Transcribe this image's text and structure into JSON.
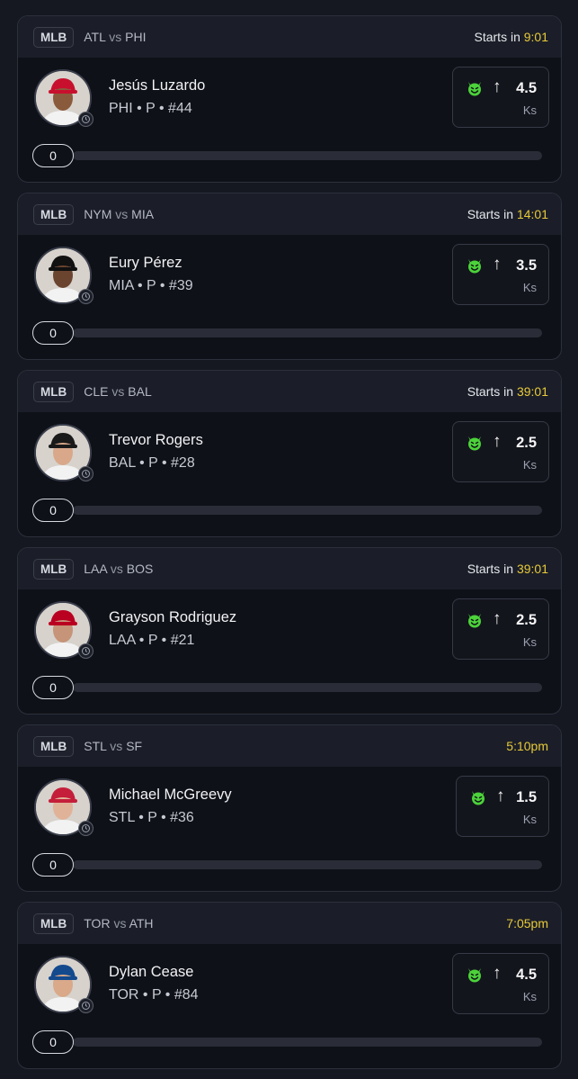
{
  "colors": {
    "countdown": "#e7c93a",
    "prop_icon": "#4cd23a",
    "background": "#151821"
  },
  "cards": [
    {
      "league": "MLB",
      "home": "ATL",
      "vs": "vs",
      "away": "PHI",
      "time_prefix": "Starts in ",
      "time_value": "9:01",
      "player": "Jesús Luzardo",
      "meta": "PHI • P • #44",
      "line": "4.5",
      "stat": "Ks",
      "direction": "up",
      "count": "0",
      "icon": "devil-icon",
      "cap": "#c8102e",
      "skin": "#8a5a3c"
    },
    {
      "league": "MLB",
      "home": "NYM",
      "vs": "vs",
      "away": "MIA",
      "time_prefix": "Starts in ",
      "time_value": "14:01",
      "player": "Eury Pérez",
      "meta": "MIA • P • #39",
      "line": "3.5",
      "stat": "Ks",
      "direction": "up",
      "count": "0",
      "icon": "devil-icon",
      "cap": "#111111",
      "skin": "#6b4430"
    },
    {
      "league": "MLB",
      "home": "CLE",
      "vs": "vs",
      "away": "BAL",
      "time_prefix": "Starts in ",
      "time_value": "39:01",
      "player": "Trevor Rogers",
      "meta": "BAL • P • #28",
      "line": "2.5",
      "stat": "Ks",
      "direction": "up",
      "count": "0",
      "icon": "devil-icon",
      "cap": "#1a1a1a",
      "skin": "#d9a88a"
    },
    {
      "league": "MLB",
      "home": "LAA",
      "vs": "vs",
      "away": "BOS",
      "time_prefix": "Starts in ",
      "time_value": "39:01",
      "player": "Grayson Rodriguez",
      "meta": "LAA • P • #21",
      "line": "2.5",
      "stat": "Ks",
      "direction": "up",
      "count": "0",
      "icon": "devil-icon",
      "cap": "#ba0021",
      "skin": "#c69478"
    },
    {
      "league": "MLB",
      "home": "STL",
      "vs": "vs",
      "away": "SF",
      "time_prefix": "",
      "time_value": "5:10pm",
      "player": "Michael McGreevy",
      "meta": "STL • P • #36",
      "line": "1.5",
      "stat": "Ks",
      "direction": "up",
      "count": "0",
      "icon": "devil-icon",
      "cap": "#c41e3a",
      "skin": "#e0b298"
    },
    {
      "league": "MLB",
      "home": "TOR",
      "vs": "vs",
      "away": "ATH",
      "time_prefix": "",
      "time_value": "7:05pm",
      "player": "Dylan Cease",
      "meta": "TOR • P • #84",
      "line": "4.5",
      "stat": "Ks",
      "direction": "up",
      "count": "0",
      "icon": "devil-icon",
      "cap": "#134a8e",
      "skin": "#d9a98a"
    }
  ]
}
